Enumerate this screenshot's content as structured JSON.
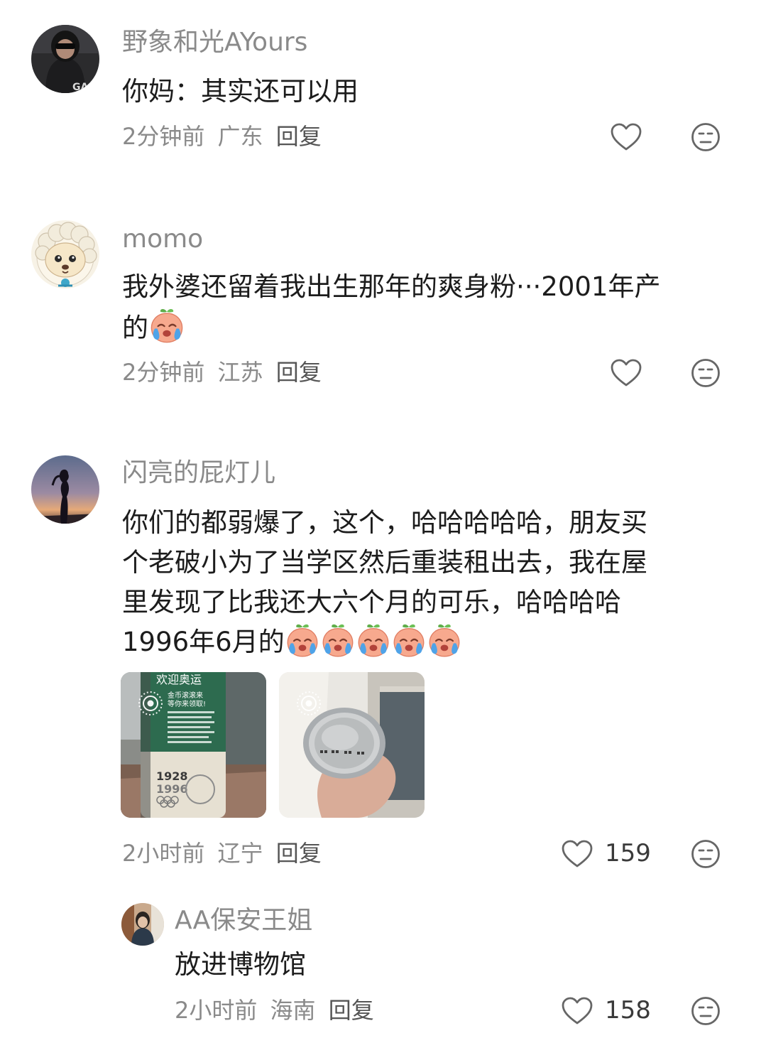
{
  "comments": [
    {
      "username": "野象和光AYours",
      "text_lines": [
        "你妈：其实还可以用"
      ],
      "time": "2分钟前",
      "location": "广东",
      "reply": "回复",
      "likes": ""
    },
    {
      "username": "momo",
      "text_lines": [
        "我外婆还留着我出生那年的爽身粉···2001年产",
        "的"
      ],
      "time": "2分钟前",
      "location": "江苏",
      "reply": "回复",
      "likes": ""
    },
    {
      "username": "闪亮的屁灯儿",
      "text_lines": [
        "你们的都弱爆了，这个，哈哈哈哈哈，朋友买",
        "个老破小为了当学区然后重装租出去，我在屋",
        "里发现了比我还大六个月的可乐，哈哈哈哈",
        "1996年6月的"
      ],
      "time": "2小时前",
      "location": "辽宁",
      "reply": "回复",
      "likes": "159",
      "photo1_text": {
        "banner": "欢迎奥运",
        "line1": "金币滚滚来",
        "line2": "等你来领取!",
        "year1": "1928",
        "year2": "1996"
      }
    }
  ],
  "reply_comment": {
    "username": "AA保安王姐",
    "text": "放进博物馆",
    "time": "2小时前",
    "location": "海南",
    "reply": "回复",
    "likes": "158"
  },
  "icons": [
    "heart-outline-icon",
    "dislike-face-icon",
    "crying-peach-emoji",
    "live-photo-icon"
  ],
  "colors": {
    "username": "#8a8a8a",
    "text": "#1c1c1c",
    "meta": "#8a8a8a",
    "icon": "#666666",
    "can_green": "#2d6b4f"
  }
}
